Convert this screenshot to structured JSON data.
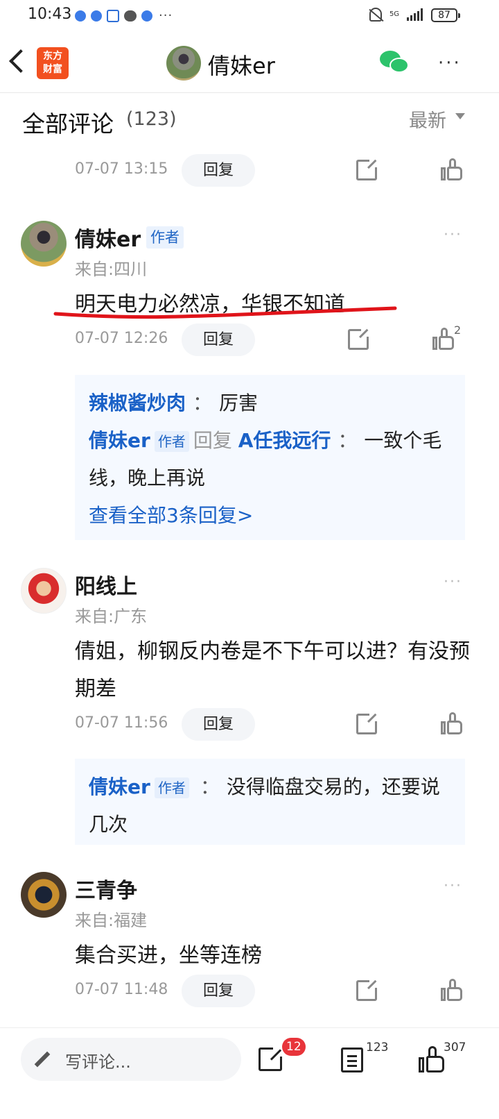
{
  "status_bar": {
    "time": "10:43",
    "network": "5G",
    "battery": "87"
  },
  "nav": {
    "logo_text": "东方\n财富",
    "title": "倩妹er"
  },
  "comments_header": {
    "title": "全部评论",
    "count": "(123)",
    "sort": "最新"
  },
  "first_row": {
    "time": "07-07 13:15",
    "reply_label": "回复"
  },
  "comments": [
    {
      "author": "倩妹er",
      "badge": "作者",
      "location": "来自:四川",
      "text": "明天电力必然凉，华银不知道",
      "time": "07-07 12:26",
      "reply_label": "回复",
      "likes": "2",
      "annotation_color": "#e0141a",
      "replies": [
        {
          "who": "辣椒酱炒肉",
          "sep": "：",
          "content": "厉害"
        },
        {
          "who": "倩妹er",
          "tag": "作者",
          "verb": "回复",
          "target": "A任我远行",
          "sep": "：",
          "content": "一致个毛线，晚上再说"
        }
      ],
      "more_replies": "查看全部3条回复>"
    },
    {
      "author": "阳线上",
      "location": "来自:广东",
      "text": "倩姐，柳钢反内卷是不下午可以进？有没预期差",
      "time": "07-07 11:56",
      "reply_label": "回复",
      "replies": [
        {
          "who": "倩妹er",
          "tag": "作者",
          "sep": "：",
          "content": "没得临盘交易的，还要说几次"
        }
      ]
    },
    {
      "author": "三青争",
      "location": "来自:福建",
      "text": "集合买进，坐等连榜",
      "time": "07-07 11:48",
      "reply_label": "回复"
    }
  ],
  "bottom_bar": {
    "compose_placeholder": "写评论...",
    "share_badge": "12",
    "comment_count": "123",
    "like_count": "307"
  },
  "colors": {
    "link_blue": "#1a61c7",
    "badge_bg": "#eaf2fd",
    "red_badge": "#e8343a",
    "wechat_green": "#2cc36b"
  }
}
